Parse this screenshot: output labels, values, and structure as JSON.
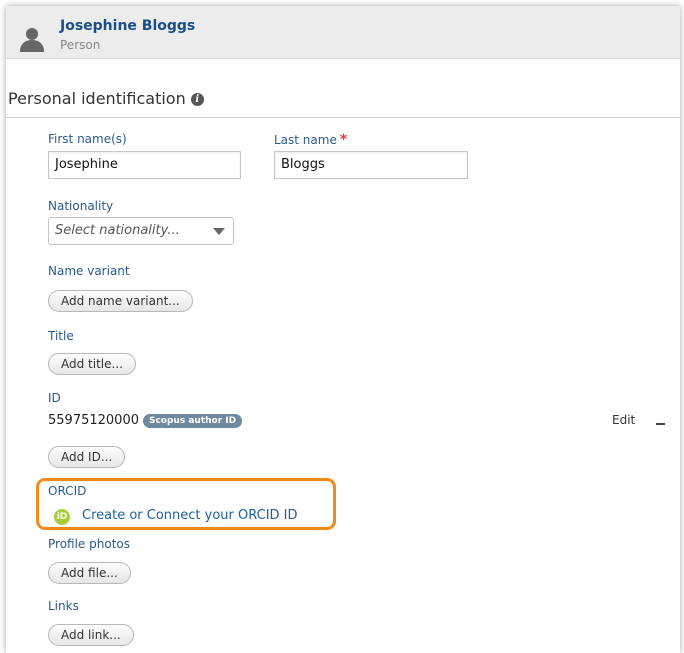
{
  "header": {
    "name": "Josephine Bloggs",
    "type": "Person",
    "avatar_icon": "person-silhouette-icon"
  },
  "section": {
    "title": "Personal identification",
    "info_icon": "info-icon",
    "info_glyph": "i"
  },
  "form": {
    "first_name": {
      "label": "First name(s)",
      "value": "Josephine"
    },
    "last_name": {
      "label": "Last name",
      "required_marker": "*",
      "value": "Bloggs"
    },
    "nationality": {
      "label": "Nationality",
      "placeholder": "Select nationality..."
    },
    "name_variant": {
      "label": "Name variant",
      "button": "Add name variant..."
    },
    "title": {
      "label": "Title",
      "button": "Add title..."
    },
    "id": {
      "label": "ID",
      "value": "55975120000",
      "badge": "Scopus author ID",
      "edit": "Edit",
      "remove_icon": "minus-icon",
      "button": "Add ID..."
    },
    "orcid": {
      "label": "ORCID",
      "icon": "orcid-icon",
      "icon_text": "iD",
      "link": "Create or Connect your ORCID ID",
      "highlight_color": "#f28a18"
    },
    "profile_photos": {
      "label": "Profile photos",
      "button": "Add file..."
    },
    "links": {
      "label": "Links",
      "button": "Add link..."
    }
  },
  "colors": {
    "label": "#2a5a8e",
    "name": "#1a4e8a",
    "required": "#e03b3b",
    "badge": "#6d8aa0",
    "orcid_green": "#a6ce39"
  }
}
